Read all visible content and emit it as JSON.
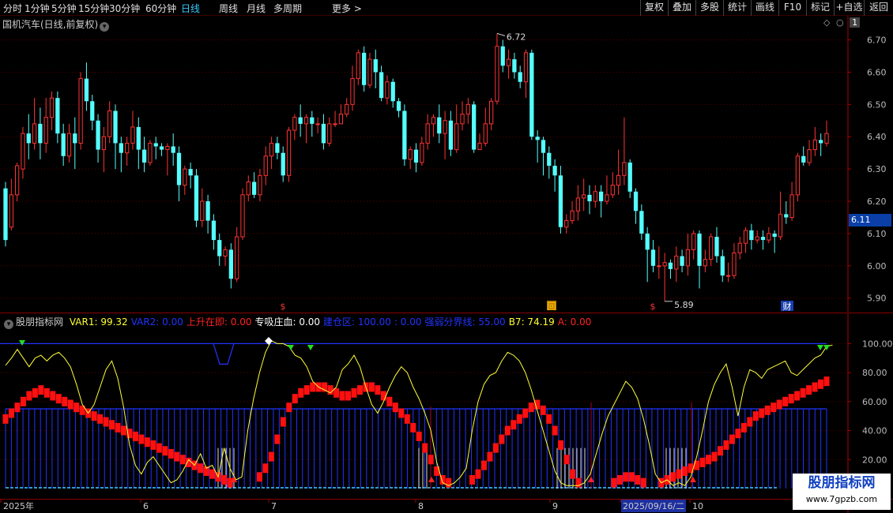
{
  "toolbar": {
    "period_tabs": [
      "分时",
      "1分钟",
      "5分钟",
      "15分钟",
      "30分钟",
      "60分钟",
      "日线",
      "周线",
      "月线",
      "多周期",
      "更多 >"
    ],
    "active_tab": "日线",
    "right_buttons": [
      "复权",
      "叠加",
      "多股",
      "统计",
      "画线",
      "F10",
      "标记",
      "+自选",
      "返回"
    ]
  },
  "main_chart": {
    "stock_title": "国机汽车(日线,前复权)",
    "panel_number": "1",
    "y_ticks": [
      "6.70",
      "6.60",
      "6.50",
      "6.40",
      "6.30",
      "6.20",
      "6.10",
      "6.00",
      "5.90"
    ],
    "last_price": "6.11",
    "high_label": "6.72",
    "low_label": "5.89",
    "event_markers": [
      "$",
      "回",
      "$",
      "财"
    ]
  },
  "sub_chart": {
    "source": "股朋指标网",
    "legend": [
      {
        "text": "VAR1: 99.32",
        "color": "#ffff33"
      },
      {
        "text": "VAR2: 0.00",
        "color": "#2233ff"
      },
      {
        "text": "上升在即: 0.00",
        "color": "#ff2222"
      },
      {
        "text": "专吸庄血: 0.00",
        "color": "#ffffff"
      },
      {
        "text": "建仓区: 100.00",
        "color": "#2233ff"
      },
      {
        "text": ": 0.00",
        "color": "#2233ff"
      },
      {
        "text": "强弱分界线: 55.00",
        "color": "#2233ff"
      },
      {
        "text": "B7: 74.19",
        "color": "#ffff33"
      },
      {
        "text": "A: 0.00",
        "color": "#ff2222"
      }
    ],
    "y_ticks": [
      "100.00",
      "80.00",
      "60.00",
      "40.00",
      "20.00"
    ]
  },
  "time_axis": {
    "labels": [
      "2025年",
      "6",
      "7",
      "8",
      "9",
      "2025/09/16/二",
      "10"
    ]
  },
  "watermark": {
    "title": "股朋指标网",
    "url": "www.7gpzb.com"
  },
  "colors": {
    "up": "#ff3333",
    "down": "#54ffff",
    "grid": "#5a0000",
    "bias_line": "#2233ff"
  },
  "chart_data": [
    {
      "type": "candlestick",
      "title": "国机汽车(日线,前复权)",
      "ylim": [
        5.87,
        6.76
      ],
      "y_ticks": [
        6.7,
        6.6,
        6.5,
        6.4,
        6.3,
        6.2,
        6.1,
        6.0,
        5.9
      ],
      "candles": [
        [
          6.24,
          6.08,
          6.26,
          6.06
        ],
        [
          6.12,
          6.22,
          6.27,
          6.11
        ],
        [
          6.22,
          6.31,
          6.32,
          6.2
        ],
        [
          6.3,
          6.41,
          6.43,
          6.27
        ],
        [
          6.41,
          6.38,
          6.47,
          6.33
        ],
        [
          6.38,
          6.44,
          6.52,
          6.36
        ],
        [
          6.44,
          6.38,
          6.49,
          6.33
        ],
        [
          6.38,
          6.46,
          6.52,
          6.35
        ],
        [
          6.46,
          6.52,
          6.54,
          6.42
        ],
        [
          6.52,
          6.41,
          6.54,
          6.38
        ],
        [
          6.41,
          6.34,
          6.44,
          6.31
        ],
        [
          6.34,
          6.41,
          6.44,
          6.32
        ],
        [
          6.41,
          6.38,
          6.46,
          6.3
        ],
        [
          6.38,
          6.58,
          6.6,
          6.36
        ],
        [
          6.58,
          6.51,
          6.63,
          6.48
        ],
        [
          6.51,
          6.45,
          6.53,
          6.42
        ],
        [
          6.45,
          6.36,
          6.47,
          6.32
        ],
        [
          6.36,
          6.4,
          6.43,
          6.29
        ],
        [
          6.4,
          6.48,
          6.51,
          6.38
        ],
        [
          6.48,
          6.38,
          6.5,
          6.3
        ],
        [
          6.38,
          6.35,
          6.4,
          6.29
        ],
        [
          6.35,
          6.38,
          6.4,
          6.31
        ],
        [
          6.38,
          6.43,
          6.48,
          6.36
        ],
        [
          6.43,
          6.36,
          6.46,
          6.3
        ],
        [
          6.36,
          6.32,
          6.4,
          6.29
        ],
        [
          6.32,
          6.38,
          6.39,
          6.31
        ],
        [
          6.38,
          6.37,
          6.4,
          6.33
        ],
        [
          6.37,
          6.36,
          6.38,
          6.34
        ],
        [
          6.36,
          6.37,
          6.38,
          6.28
        ],
        [
          6.37,
          6.35,
          6.41,
          6.31
        ],
        [
          6.35,
          6.25,
          6.37,
          6.2
        ],
        [
          6.25,
          6.3,
          6.31,
          6.22
        ],
        [
          6.3,
          6.28,
          6.32,
          6.24
        ],
        [
          6.28,
          6.14,
          6.3,
          6.12
        ],
        [
          6.14,
          6.2,
          6.24,
          6.12
        ],
        [
          6.2,
          6.14,
          6.22,
          6.1
        ],
        [
          6.14,
          6.08,
          6.16,
          6.05
        ],
        [
          6.08,
          6.03,
          6.1,
          6.0
        ],
        [
          6.03,
          6.05,
          6.06,
          6.0
        ],
        [
          6.05,
          5.96,
          6.07,
          5.93
        ],
        [
          5.96,
          6.09,
          6.12,
          5.95
        ],
        [
          6.09,
          6.22,
          6.24,
          6.08
        ],
        [
          6.22,
          6.26,
          6.28,
          6.2
        ],
        [
          6.26,
          6.22,
          6.29,
          6.21
        ],
        [
          6.22,
          6.28,
          6.3,
          6.2
        ],
        [
          6.28,
          6.34,
          6.37,
          6.25
        ],
        [
          6.34,
          6.38,
          6.4,
          6.3
        ],
        [
          6.38,
          6.35,
          6.4,
          6.33
        ],
        [
          6.35,
          6.28,
          6.37,
          6.26
        ],
        [
          6.28,
          6.42,
          6.43,
          6.26
        ],
        [
          6.42,
          6.46,
          6.47,
          6.39
        ],
        [
          6.46,
          6.44,
          6.5,
          6.4
        ],
        [
          6.44,
          6.46,
          6.47,
          6.38
        ],
        [
          6.46,
          6.44,
          6.48,
          6.4
        ],
        [
          6.44,
          6.44,
          6.46,
          6.41
        ],
        [
          6.44,
          6.38,
          6.47,
          6.36
        ],
        [
          6.38,
          6.44,
          6.46,
          6.37
        ],
        [
          6.44,
          6.44,
          6.48,
          6.43
        ],
        [
          6.44,
          6.47,
          6.5,
          6.44
        ],
        [
          6.47,
          6.5,
          6.52,
          6.46
        ],
        [
          6.5,
          6.58,
          6.62,
          6.48
        ],
        [
          6.58,
          6.66,
          6.67,
          6.56
        ],
        [
          6.66,
          6.56,
          6.68,
          6.54
        ],
        [
          6.56,
          6.64,
          6.66,
          6.55
        ],
        [
          6.64,
          6.6,
          6.67,
          6.55
        ],
        [
          6.6,
          6.52,
          6.62,
          6.51
        ],
        [
          6.52,
          6.57,
          6.59,
          6.5
        ],
        [
          6.57,
          6.51,
          6.58,
          6.49
        ],
        [
          6.51,
          6.48,
          6.52,
          6.46
        ],
        [
          6.48,
          6.33,
          6.5,
          6.31
        ],
        [
          6.33,
          6.36,
          6.37,
          6.3
        ],
        [
          6.36,
          6.32,
          6.38,
          6.29
        ],
        [
          6.32,
          6.38,
          6.4,
          6.31
        ],
        [
          6.38,
          6.44,
          6.47,
          6.36
        ],
        [
          6.44,
          6.46,
          6.47,
          6.4
        ],
        [
          6.46,
          6.41,
          6.5,
          6.38
        ],
        [
          6.41,
          6.45,
          6.48,
          6.33
        ],
        [
          6.45,
          6.36,
          6.48,
          6.34
        ],
        [
          6.36,
          6.44,
          6.5,
          6.35
        ],
        [
          6.44,
          6.47,
          6.51,
          6.42
        ],
        [
          6.47,
          6.5,
          6.52,
          6.44
        ],
        [
          6.5,
          6.36,
          6.51,
          6.35
        ],
        [
          6.36,
          6.38,
          6.41,
          6.36
        ],
        [
          6.38,
          6.44,
          6.49,
          6.37
        ],
        [
          6.44,
          6.51,
          6.52,
          6.42
        ],
        [
          6.51,
          6.68,
          6.72,
          6.5
        ],
        [
          6.68,
          6.62,
          6.7,
          6.6
        ],
        [
          6.62,
          6.64,
          6.67,
          6.58
        ],
        [
          6.64,
          6.6,
          6.66,
          6.58
        ],
        [
          6.6,
          6.57,
          6.62,
          6.55
        ],
        [
          6.57,
          6.66,
          6.67,
          6.52
        ],
        [
          6.66,
          6.4,
          6.67,
          6.39
        ],
        [
          6.4,
          6.39,
          6.42,
          6.32
        ],
        [
          6.39,
          6.35,
          6.4,
          6.28
        ],
        [
          6.35,
          6.31,
          6.37,
          6.27
        ],
        [
          6.31,
          6.28,
          6.33,
          6.23
        ],
        [
          6.28,
          6.12,
          6.31,
          6.1
        ],
        [
          6.12,
          6.14,
          6.16,
          6.1
        ],
        [
          6.14,
          6.17,
          6.2,
          6.13
        ],
        [
          6.17,
          6.21,
          6.25,
          6.14
        ],
        [
          6.21,
          6.22,
          6.27,
          6.17
        ],
        [
          6.22,
          6.2,
          6.25,
          6.16
        ],
        [
          6.2,
          6.23,
          6.25,
          6.18
        ],
        [
          6.23,
          6.2,
          6.25,
          6.15
        ],
        [
          6.2,
          6.22,
          6.28,
          6.19
        ],
        [
          6.22,
          6.25,
          6.29,
          6.21
        ],
        [
          6.25,
          6.28,
          6.36,
          6.22
        ],
        [
          6.28,
          6.32,
          6.46,
          6.25
        ],
        [
          6.32,
          6.23,
          6.33,
          6.21
        ],
        [
          6.23,
          6.17,
          6.24,
          6.13
        ],
        [
          6.17,
          6.1,
          6.19,
          6.08
        ],
        [
          6.1,
          6.05,
          6.12,
          5.95
        ],
        [
          6.05,
          6.0,
          6.08,
          5.98
        ],
        [
          6.0,
          6.0,
          6.06,
          5.96
        ],
        [
          6.0,
          6.01,
          6.04,
          5.89
        ],
        [
          6.01,
          5.99,
          6.02,
          5.96
        ],
        [
          5.99,
          6.03,
          6.06,
          5.95
        ],
        [
          6.03,
          6.0,
          6.05,
          5.98
        ],
        [
          6.0,
          6.05,
          6.1,
          5.97
        ],
        [
          6.05,
          6.1,
          6.11,
          6.02
        ],
        [
          6.1,
          6.0,
          6.11,
          5.93
        ],
        [
          6.0,
          6.02,
          6.05,
          5.98
        ],
        [
          6.02,
          6.09,
          6.1,
          6.0
        ],
        [
          6.09,
          6.03,
          6.12,
          6.01
        ],
        [
          6.03,
          5.97,
          6.05,
          5.95
        ],
        [
          5.97,
          5.97,
          6.01,
          5.95
        ],
        [
          5.97,
          6.04,
          6.07,
          5.96
        ],
        [
          6.04,
          6.07,
          6.09,
          6.02
        ],
        [
          6.07,
          6.11,
          6.12,
          6.04
        ],
        [
          6.11,
          6.08,
          6.13,
          6.05
        ],
        [
          6.08,
          6.09,
          6.11,
          6.07
        ],
        [
          6.09,
          6.08,
          6.11,
          6.05
        ],
        [
          6.08,
          6.1,
          6.12,
          6.07
        ],
        [
          6.1,
          6.09,
          6.11,
          6.04
        ],
        [
          6.09,
          6.16,
          6.23,
          6.08
        ],
        [
          6.16,
          6.15,
          6.2,
          6.13
        ],
        [
          6.15,
          6.22,
          6.26,
          6.14
        ],
        [
          6.22,
          6.34,
          6.35,
          6.2
        ],
        [
          6.34,
          6.32,
          6.37,
          6.31
        ],
        [
          6.32,
          6.36,
          6.39,
          6.31
        ],
        [
          6.36,
          6.39,
          6.43,
          6.34
        ],
        [
          6.39,
          6.38,
          6.41,
          6.34
        ],
        [
          6.38,
          6.41,
          6.45,
          6.37
        ]
      ]
    },
    {
      "type": "line",
      "title": "股朋指标网",
      "ylim": [
        0,
        110
      ],
      "y_ticks": [
        100,
        80,
        60,
        40,
        20
      ],
      "reference_lines": [
        {
          "name": "强弱分界线",
          "value": 55
        },
        {
          "name": "建仓区",
          "value": 100
        }
      ],
      "series": [
        {
          "name": "B7",
          "values": [
            85,
            90,
            96,
            90,
            84,
            90,
            92,
            88,
            92,
            94,
            90,
            84,
            72,
            58,
            52,
            58,
            70,
            82,
            88,
            76,
            56,
            30,
            16,
            10,
            18,
            22,
            16,
            10,
            4,
            6,
            12,
            20,
            16,
            24,
            14,
            16,
            8,
            28,
            14,
            6,
            8,
            40,
            62,
            80,
            94,
            102,
            100,
            100,
            98,
            92,
            90,
            84,
            74,
            70,
            68,
            66,
            70,
            82,
            86,
            92,
            84,
            70,
            58,
            52,
            60,
            70,
            78,
            84,
            80,
            70,
            62,
            52,
            40,
            18,
            4,
            2,
            4,
            8,
            14,
            40,
            60,
            72,
            78,
            80,
            88,
            94,
            92,
            88,
            80,
            68,
            54,
            40,
            26,
            12,
            4,
            2,
            2,
            2,
            4,
            10,
            24,
            38,
            50,
            58,
            66,
            74,
            70,
            62,
            48,
            30,
            10,
            4,
            6,
            2,
            4,
            2,
            8,
            22,
            40,
            60,
            72,
            80,
            86,
            70,
            50,
            70,
            82,
            80,
            76,
            82,
            84,
            86,
            88,
            80,
            78,
            82,
            86,
            90,
            92,
            98,
            99
          ]
        },
        {
          "name": "A",
          "values": [
            48,
            52,
            56,
            60,
            64,
            66,
            68,
            66,
            64,
            62,
            60,
            58,
            56,
            54,
            52,
            50,
            48,
            46,
            44,
            42,
            40,
            38,
            36,
            34,
            32,
            30,
            28,
            26,
            24,
            22,
            20,
            18,
            16,
            14,
            12,
            10,
            8,
            6,
            4,
            2,
            2,
            2,
            2,
            8,
            14,
            22,
            34,
            46,
            56,
            62,
            66,
            68,
            70,
            70,
            70,
            68,
            66,
            64,
            64,
            66,
            68,
            70,
            70,
            68,
            64,
            60,
            56,
            52,
            48,
            42,
            36,
            28,
            20,
            12,
            6,
            4,
            2,
            2,
            2,
            6,
            10,
            16,
            22,
            28,
            34,
            40,
            44,
            48,
            52,
            56,
            58,
            54,
            48,
            40,
            30,
            20,
            10,
            4,
            2,
            2,
            2,
            2,
            2,
            4,
            6,
            8,
            8,
            6,
            4,
            2,
            2,
            4,
            6,
            8,
            10,
            12,
            14,
            16,
            18,
            20,
            22,
            26,
            30,
            34,
            38,
            42,
            46,
            50,
            52,
            54,
            56,
            58,
            60,
            62,
            64,
            66,
            68,
            70,
            72,
            74
          ]
        }
      ]
    }
  ]
}
